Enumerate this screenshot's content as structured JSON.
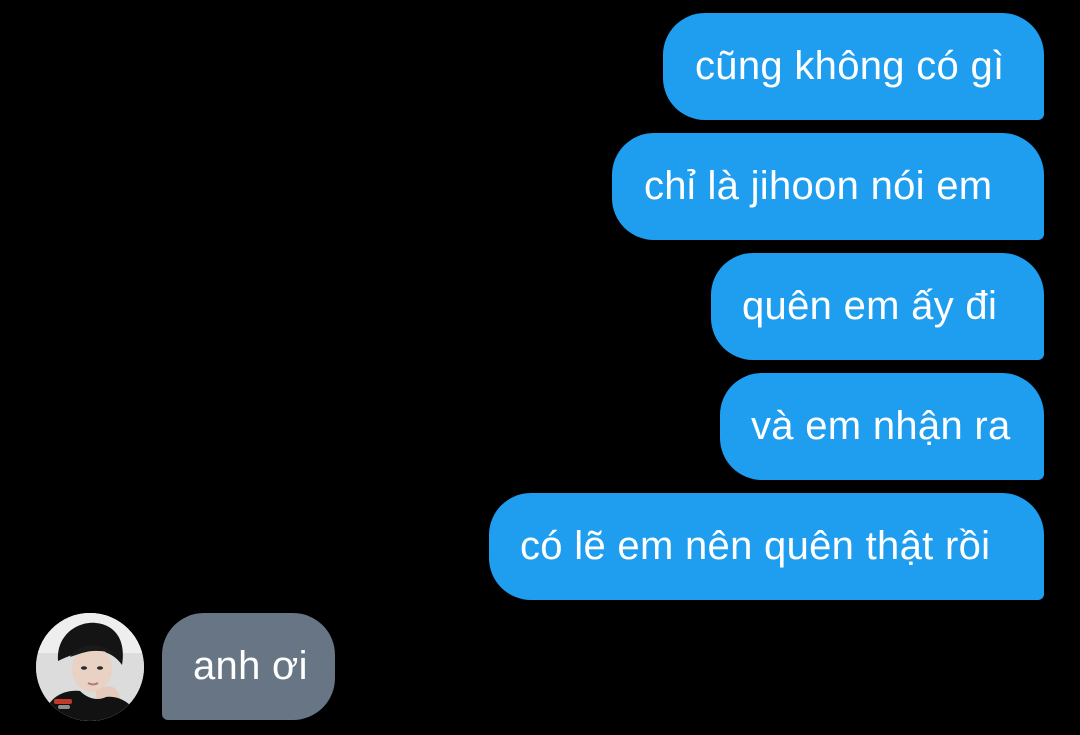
{
  "conversation": {
    "sent_messages": [
      {
        "text": "cũng không có gì"
      },
      {
        "text": "chỉ là jihoon nói em"
      },
      {
        "text": "quên em ấy đi"
      },
      {
        "text": "và em nhận ra"
      },
      {
        "text": "có lẽ em nên quên thật rồi"
      }
    ],
    "received_messages": [
      {
        "text": "anh ơi"
      }
    ]
  },
  "colors": {
    "background": "#000000",
    "sent_bubble": "#1f9ef0",
    "received_bubble": "#687584",
    "text": "#ffffff"
  }
}
